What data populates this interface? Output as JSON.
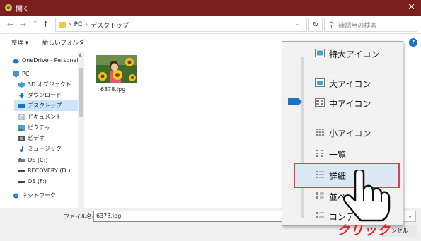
{
  "window": {
    "title": "開く",
    "close": "✕"
  },
  "address": {
    "back": "←",
    "forward": "→",
    "history": "⌄",
    "up": "↑",
    "crumbs": [
      "PC",
      "デスクトップ"
    ],
    "refresh": "↻",
    "search_placeholder": "確認用の検索"
  },
  "toolbar": {
    "organize": "整理 ▾",
    "new_folder": "新しいフォルダー",
    "help": "?"
  },
  "sidebar": {
    "items": [
      {
        "label": "OneDrive - Personal",
        "icon": "cloud-icon",
        "color": "#1a73c8"
      },
      {
        "label": "PC",
        "icon": "computer-icon",
        "color": "#4a90d9"
      },
      {
        "label": "3D オブジェクト",
        "icon": "cube-icon",
        "color": "#39a0d8"
      },
      {
        "label": "ダウンロード",
        "icon": "download-icon",
        "color": "#1a73c8"
      },
      {
        "label": "デスクトップ",
        "icon": "desktop-icon",
        "color": "#1a73c8"
      },
      {
        "label": "ドキュメント",
        "icon": "document-icon",
        "color": "#7a8fa6"
      },
      {
        "label": "ピクチャ",
        "icon": "picture-icon",
        "color": "#4aa0d8"
      },
      {
        "label": "ビデオ",
        "icon": "video-icon",
        "color": "#555555"
      },
      {
        "label": "ミュージック",
        "icon": "music-icon",
        "color": "#1a73c8"
      },
      {
        "label": "OS (C:)",
        "icon": "drive-icon",
        "color": "#777777"
      },
      {
        "label": "RECOVERY (D:)",
        "icon": "drive-icon",
        "color": "#444444"
      },
      {
        "label": "OS (F:)",
        "icon": "drive-icon",
        "color": "#444444"
      },
      {
        "label": "ネットワーク",
        "icon": "network-icon",
        "color": "#1a73c8"
      }
    ]
  },
  "files": [
    {
      "name": "6378.jpg"
    }
  ],
  "bottom": {
    "filename_label": "ファイル名(N):",
    "filename_value": "6378.jpg",
    "cancel": "ンセル"
  },
  "view_menu": {
    "items": [
      {
        "label": "特大アイコン",
        "icon": "extra-large-icons-icon"
      },
      {
        "label": "大アイコン",
        "icon": "large-icons-icon"
      },
      {
        "label": "中アイコン",
        "icon": "medium-icons-icon"
      },
      {
        "label": "小アイコン",
        "icon": "small-icons-icon"
      },
      {
        "label": "一覧",
        "icon": "list-icon"
      },
      {
        "label": "詳細",
        "icon": "details-icon"
      },
      {
        "label": "並べ",
        "icon": "tiles-icon"
      },
      {
        "label": "コンテ",
        "icon": "content-icon"
      }
    ],
    "selected": "詳細"
  },
  "annotation": {
    "click": "クリック"
  },
  "colors": {
    "titlebar": "#7a1f1e",
    "accent": "#1a73c8",
    "highlight_border": "#e04040",
    "click_text": "#e0202a"
  }
}
